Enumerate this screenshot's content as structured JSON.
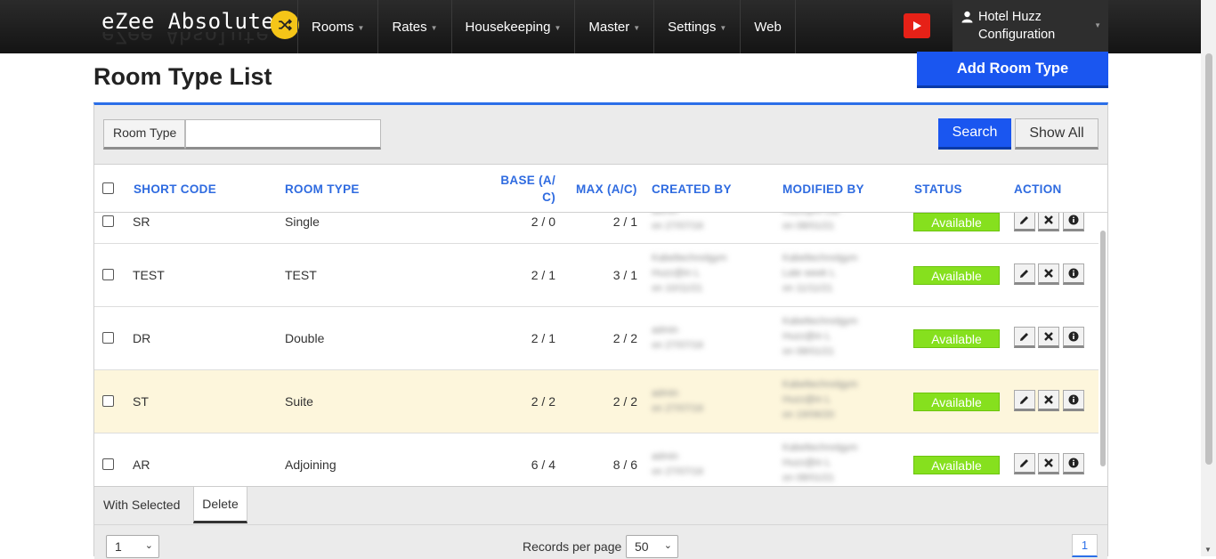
{
  "app": {
    "brand": "eZee Absolute",
    "nav": [
      {
        "label": "Rooms",
        "has_caret": true
      },
      {
        "label": "Rates",
        "has_caret": true
      },
      {
        "label": "Housekeeping",
        "has_caret": true
      },
      {
        "label": "Master",
        "has_caret": true
      },
      {
        "label": "Settings",
        "has_caret": true
      },
      {
        "label": "Web",
        "has_caret": false
      }
    ],
    "user": {
      "line1": "Hotel Huzz",
      "line2": "Configuration"
    },
    "accent": "#1a56f0",
    "status_color": "#86e01e"
  },
  "page": {
    "title": "Room Type List",
    "add_button": "Add Room Type"
  },
  "filter": {
    "label": "Room Type",
    "value": "",
    "search_button": "Search",
    "show_all_button": "Show All"
  },
  "table": {
    "headers": {
      "short_code": "SHORT CODE",
      "room_type": "ROOM TYPE",
      "base_line1": "BASE (A/",
      "base_line2": "C)",
      "max": "MAX (A/C)",
      "created_by": "CREATED BY",
      "modified_by": "MODIFIED BY",
      "status": "STATUS",
      "action": "ACTION"
    },
    "rows": [
      {
        "code": "SR",
        "type": "Single",
        "base": "2 / 0",
        "max": "2 / 1",
        "status": "Available"
      },
      {
        "code": "TEST",
        "type": "TEST",
        "base": "2 / 1",
        "max": "3 / 1",
        "status": "Available"
      },
      {
        "code": "DR",
        "type": "Double",
        "base": "2 / 1",
        "max": "2 / 2",
        "status": "Available"
      },
      {
        "code": "ST",
        "type": "Suite",
        "base": "2 / 2",
        "max": "2 / 2",
        "status": "Available"
      },
      {
        "code": "AR",
        "type": "Adjoining",
        "base": "6 / 4",
        "max": "8 / 6",
        "status": "Available"
      }
    ]
  },
  "footer": {
    "with_selected": "With Selected",
    "delete": "Delete",
    "page_select": "1",
    "records_label": "Records per page",
    "records_value": "50",
    "current_page": "1"
  }
}
